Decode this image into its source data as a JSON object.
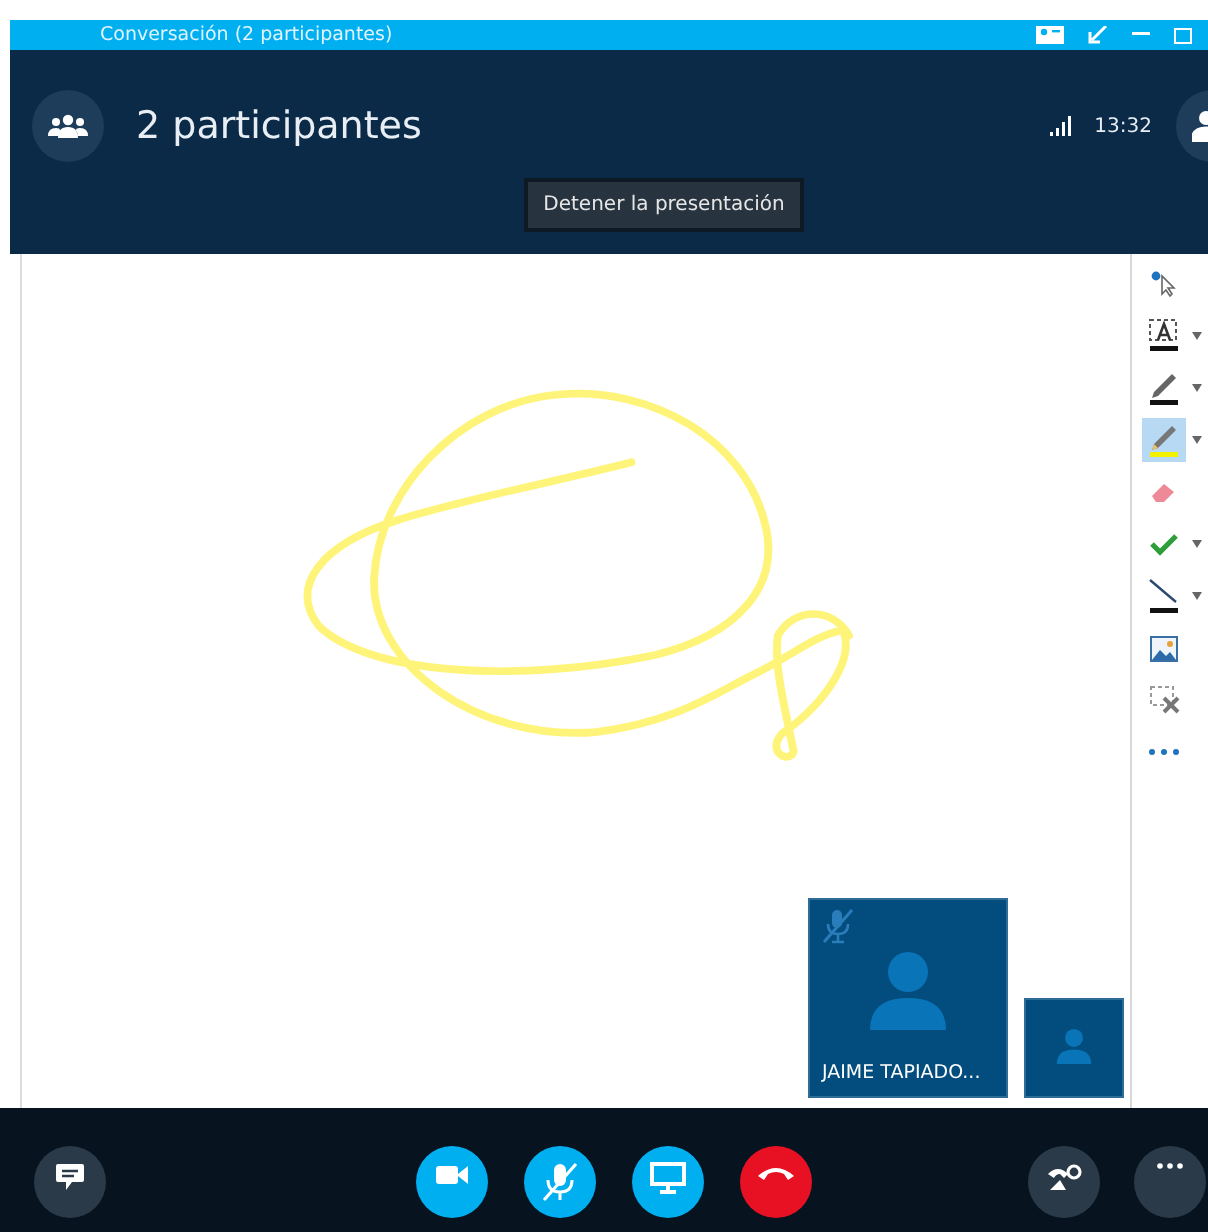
{
  "window": {
    "title": "Conversación (2 participantes)"
  },
  "header": {
    "title": "2 participantes",
    "time": "13:32"
  },
  "tooltip": "Detener la presentación",
  "tools": [
    {
      "kind": "pointer",
      "selected": false,
      "dropdown": false
    },
    {
      "kind": "text",
      "selected": false,
      "dropdown": true
    },
    {
      "kind": "pen",
      "selected": false,
      "dropdown": true
    },
    {
      "kind": "highlighter",
      "selected": true,
      "dropdown": true
    },
    {
      "kind": "eraser",
      "selected": false,
      "dropdown": false
    },
    {
      "kind": "stamp",
      "selected": false,
      "dropdown": true
    },
    {
      "kind": "line",
      "selected": false,
      "dropdown": true
    },
    {
      "kind": "image",
      "selected": false,
      "dropdown": false
    },
    {
      "kind": "delete",
      "selected": false,
      "dropdown": false
    },
    {
      "kind": "more",
      "selected": false,
      "dropdown": false
    }
  ],
  "participants": [
    {
      "name": "JAIME TAPIADO...",
      "muted": true,
      "kind": "main"
    },
    {
      "kind": "self",
      "muted": false
    }
  ],
  "controls": [
    {
      "kind": "chat"
    },
    {
      "kind": "video"
    },
    {
      "kind": "mic",
      "muted": true
    },
    {
      "kind": "present"
    },
    {
      "kind": "hangup"
    },
    {
      "kind": "call"
    },
    {
      "kind": "more"
    }
  ]
}
